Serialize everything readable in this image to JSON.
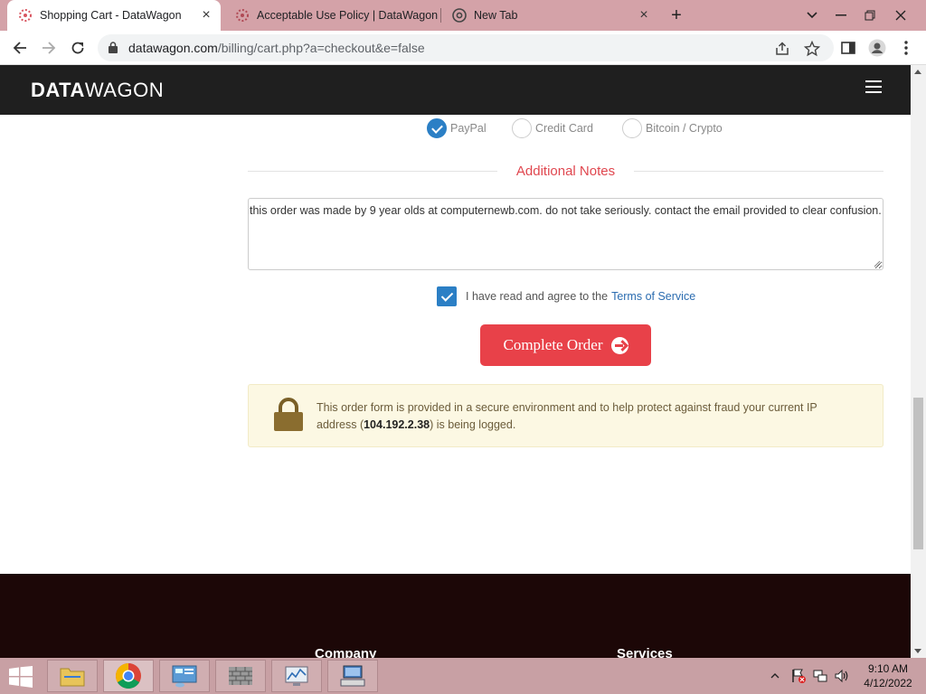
{
  "browser": {
    "tabs": [
      {
        "title": "Shopping Cart - DataWagon",
        "active": true
      },
      {
        "title": "Acceptable Use Policy | DataWagon",
        "active": false
      },
      {
        "title": "New Tab",
        "active": false
      }
    ],
    "url_host": "datawagon.com",
    "url_path": "/billing/cart.php?a=checkout&e=false"
  },
  "site": {
    "logo_bold": "DATA",
    "logo_light": "WAGON"
  },
  "payment": {
    "options": [
      {
        "label": "PayPal",
        "selected": true
      },
      {
        "label": "Credit Card",
        "selected": false
      },
      {
        "label": "Bitcoin / Crypto",
        "selected": false
      }
    ]
  },
  "notes": {
    "heading": "Additional Notes",
    "value": "this order was made by 9 year olds at computernewb.com. do not take seriously. contact the email provided to clear confusion."
  },
  "tos": {
    "text": "I have read and agree to the",
    "link": "Terms of Service",
    "checked": true
  },
  "order": {
    "button_label": "Complete Order"
  },
  "secure_notice": {
    "before": "This order form is provided in a secure environment and to help protect against fraud your current IP address (",
    "ip": "104.192.2.38",
    "after": ") is being logged."
  },
  "footer": {
    "col1": "Company",
    "col2": "Services"
  },
  "taskbar": {
    "time": "9:10 AM",
    "date": "4/12/2022"
  },
  "colors": {
    "accent_red": "#e84149",
    "checkbox_blue": "#2b7fc5",
    "header_bg": "#1f1f1f",
    "footer_bg": "#1c0707",
    "tab_strip": "#d4a2a8"
  }
}
